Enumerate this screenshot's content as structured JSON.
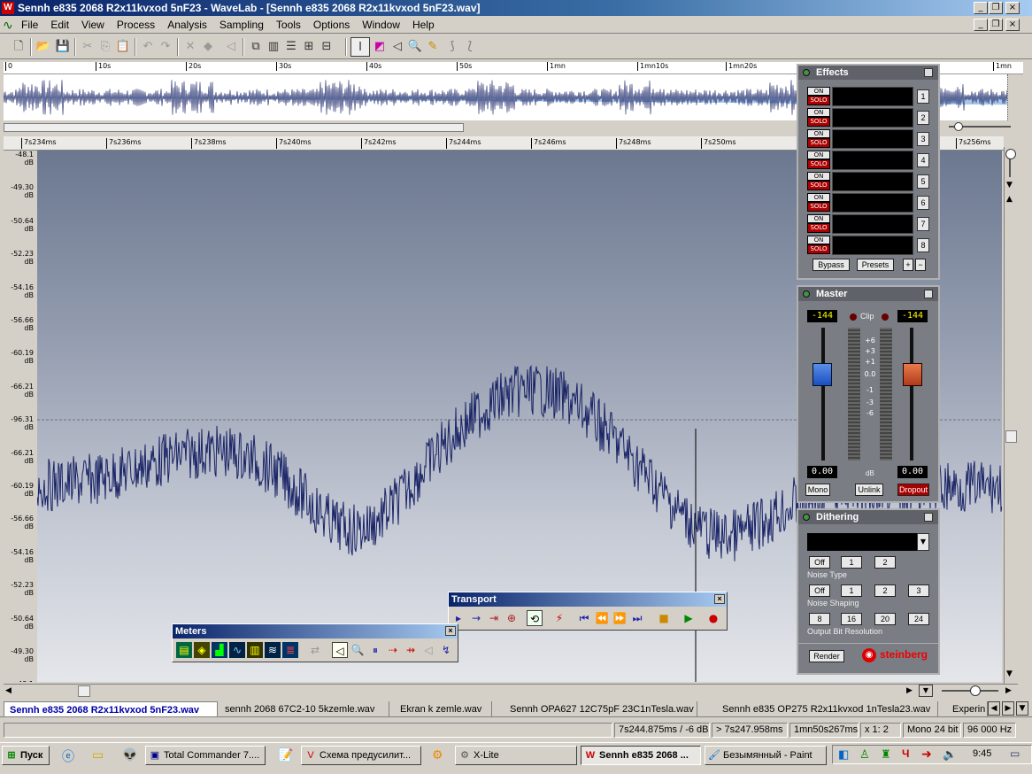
{
  "window": {
    "title": "Sennh e835 2068 R2x11kvxod  5nF23 - WaveLab - [Sennh e835 2068 R2x11kvxod  5nF23.wav]"
  },
  "menu": [
    "File",
    "Edit",
    "View",
    "Process",
    "Analysis",
    "Sampling",
    "Tools",
    "Options",
    "Window",
    "Help"
  ],
  "ruler_top": [
    "0",
    "10s",
    "20s",
    "30s",
    "40s",
    "50s",
    "1mn",
    "1mn10s",
    "1mn20s",
    "1mn"
  ],
  "ruler_zoom": [
    "7s234ms",
    "7s236ms",
    "7s238ms",
    "7s240ms",
    "7s242ms",
    "7s244ms",
    "7s246ms",
    "7s248ms",
    "7s250ms",
    "7s256ms"
  ],
  "y_labels": [
    "-48.1\ndB",
    "-49.30\ndB",
    "-50.64\ndB",
    "-52.23\ndB",
    "-54.16\ndB",
    "-56.66\ndB",
    "-60.19\ndB",
    "-66.21\ndB",
    "-96.31\ndB",
    "-66.21\ndB",
    "-60.19\ndB",
    "-56.66\ndB",
    "-54.16\ndB",
    "-52.23\ndB",
    "-50.64\ndB",
    "-49.30\ndB",
    "-48.1\ndB"
  ],
  "effects": {
    "title": "Effects",
    "on": "ON",
    "solo": "SOLO",
    "slots": [
      "1",
      "2",
      "3",
      "4",
      "5",
      "6",
      "7",
      "8"
    ],
    "bypass": "Bypass",
    "presets": "Presets",
    "plus": "+",
    "minus": "−"
  },
  "master": {
    "title": "Master",
    "peak_left": "-144",
    "peak_right": "-144",
    "clip": "Clip",
    "scale": [
      "+6",
      "+3",
      "+1",
      "0.0",
      "-1",
      "-3",
      "-6"
    ],
    "level_left": "0.00",
    "level_right": "0.00",
    "db": "dB",
    "mono": "Mono",
    "unlink": "Unlink",
    "dropout": "Dropout"
  },
  "dithering": {
    "title": "Dithering",
    "off": "Off",
    "noise_type_label": "Noise  Type",
    "noise_type": [
      "1",
      "2"
    ],
    "noise_shaping_label": "Noise  Shaping",
    "noise_shaping": [
      "1",
      "2",
      "3"
    ],
    "bits": [
      "8",
      "16",
      "20",
      "24"
    ],
    "bit_res_label": "Output Bit Resolution",
    "render": "Render",
    "brand": "steinberg"
  },
  "transport": {
    "title": "Transport"
  },
  "meters": {
    "title": "Meters"
  },
  "tabs": [
    "Sennh e835 2068 R2x11kvxod  5nF23.wav",
    "sennh 2068 67C2-10 5kzemle.wav",
    "Ekran k zemle.wav",
    "Sennh OPA627 12C75pF 23C1nTesla.wav",
    "Sennh e835 OP275 R2x11kvxod  1nTesla23.wav",
    "Experin"
  ],
  "status": {
    "position": "7s244.875ms / -6 dB",
    "selection": "> 7s247.958ms",
    "length": "1mn50s267ms",
    "zoom": "x 1: 2",
    "format": "Mono 24 bit",
    "rate": "96 000 Hz"
  },
  "taskbar": {
    "start": "Пуск",
    "items": [
      "Total Commander 7....",
      "Схема предусилит...",
      "X-Lite",
      "Sennh e835 2068 ...",
      "Безымянный - Paint"
    ],
    "lang": "Ч",
    "clock": "9:45"
  },
  "colors": {
    "waveform": "#1a2466",
    "title_bar": "#0a246a",
    "panel": "#7a7e84"
  }
}
